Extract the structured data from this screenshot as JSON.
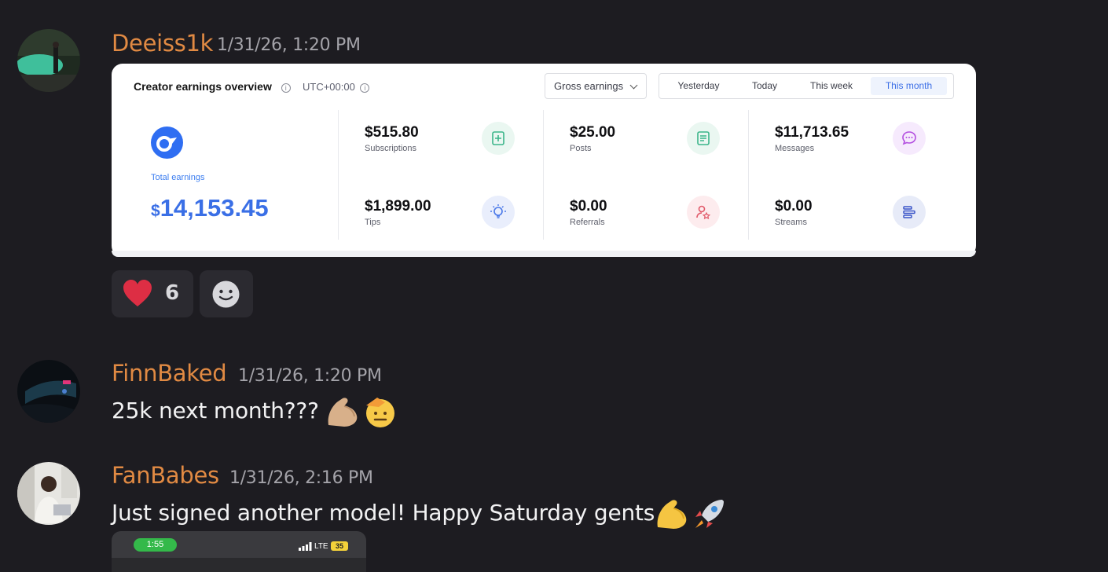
{
  "messages": [
    {
      "username": "Deeiss1k",
      "timestamp": "1/31/26, 1:20 PM",
      "embed": {
        "title": "Creator earnings overview",
        "timezone": "UTC+00:00",
        "dropdown_label": "Gross earnings",
        "periods": [
          "Yesterday",
          "Today",
          "This week",
          "This month"
        ],
        "active_period": "This month",
        "total_label": "Total earnings",
        "total_currency": "$",
        "total_value": "14,153.45",
        "stats": [
          {
            "value": "$515.80",
            "label": "Subscriptions",
            "icon": "subscriptions-icon"
          },
          {
            "value": "$1,899.00",
            "label": "Tips",
            "icon": "tips-lightbulb-icon"
          },
          {
            "value": "$25.00",
            "label": "Posts",
            "icon": "posts-icon"
          },
          {
            "value": "$0.00",
            "label": "Referrals",
            "icon": "referrals-icon"
          },
          {
            "value": "$11,713.65",
            "label": "Messages",
            "icon": "messages-icon"
          },
          {
            "value": "$0.00",
            "label": "Streams",
            "icon": "streams-icon"
          }
        ]
      },
      "reactions": [
        {
          "emoji": "heart",
          "count": "6"
        },
        {
          "emoji": "add-reaction"
        }
      ]
    },
    {
      "username": "FinnBaked",
      "timestamp": "1/31/26, 1:20 PM",
      "text": "25k next month???",
      "emojis": [
        "flexed-biceps-icon",
        "saluting-face-icon"
      ]
    },
    {
      "username": "FanBabes",
      "timestamp": "1/31/26, 2:16 PM",
      "text": "Just signed another model! Happy Saturday gents",
      "emojis": [
        "flexed-biceps-icon",
        "rocket-icon"
      ],
      "attachment": {
        "status_time": "1:55",
        "network": "LTE",
        "battery": "35"
      }
    }
  ],
  "colors": {
    "background": "#1d1c21",
    "username": "#e18a43",
    "timestamp": "#a4a3a9",
    "accent_blue": "#3a6fe6"
  }
}
